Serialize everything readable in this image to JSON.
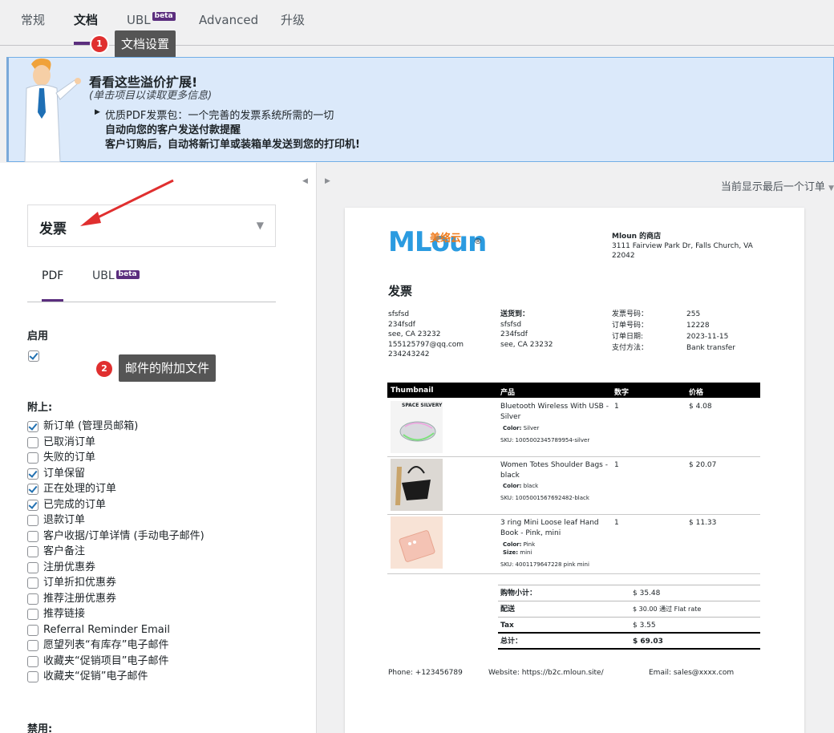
{
  "tabs": {
    "items": [
      {
        "label": "常规"
      },
      {
        "label": "文档"
      },
      {
        "label": "UBL",
        "badge": "beta"
      },
      {
        "label": "Advanced"
      },
      {
        "label": "升级"
      }
    ],
    "active": "文档"
  },
  "callouts": [
    {
      "num": "1",
      "label": "文档设置"
    },
    {
      "num": "2",
      "label": "邮件的附加文件"
    }
  ],
  "promo": {
    "title": "看看这些溢价扩展!",
    "subtitle": "(单击项目以读取更多信息)",
    "item1": "优质PDF发票包：一个完善的发票系统所需的一切",
    "item2": "自动向您的客户发送付款提醒",
    "item3": "客户订购后，自动将新订单或装箱单发送到您的打印机!"
  },
  "left": {
    "document_select": "发票",
    "subtabs": [
      {
        "label": "PDF"
      },
      {
        "label": "UBL",
        "badge": "beta"
      }
    ],
    "enable_label": "启用",
    "enable_checked": true,
    "attach_label": "附上:",
    "attach_items": [
      {
        "label": "新订单 (管理员邮箱)",
        "checked": true
      },
      {
        "label": "已取消订单",
        "checked": false
      },
      {
        "label": "失败的订单",
        "checked": false
      },
      {
        "label": "订单保留",
        "checked": true
      },
      {
        "label": "正在处理的订单",
        "checked": true
      },
      {
        "label": "已完成的订单",
        "checked": true
      },
      {
        "label": "退款订单",
        "checked": false
      },
      {
        "label": "客户收据/订单详情 (手动电子邮件)",
        "checked": false
      },
      {
        "label": "客户备注",
        "checked": false
      },
      {
        "label": "注册优惠券",
        "checked": false
      },
      {
        "label": "订单折扣优惠券",
        "checked": false
      },
      {
        "label": "推荐注册优惠券",
        "checked": false
      },
      {
        "label": "推荐链接",
        "checked": false
      },
      {
        "label": "Referral Reminder Email",
        "checked": false
      },
      {
        "label": "愿望列表“有库存”电子邮件",
        "checked": false
      },
      {
        "label": "收藏夹“促销项目”电子邮件",
        "checked": false
      },
      {
        "label": "收藏夹“促销”电子邮件",
        "checked": false
      }
    ],
    "disable_label": "禁用:"
  },
  "right": {
    "preview_select": "当前显示最后一个订单"
  },
  "invoice": {
    "logo_text": "MLoun",
    "logo_cn": "美络云",
    "shop_name": "Mloun 的商店",
    "shop_addr1": "3111 Fairview Park Dr, Falls Church, VA",
    "shop_addr2": "22042",
    "title": "发票",
    "billing": [
      "sfsfsd",
      "234fsdf",
      "see, CA 23232",
      "155125797@qq.com",
      "234243242"
    ],
    "ship_label": "送货到：",
    "shipping": [
      "sfsfsd",
      "234fsdf",
      "see, CA 23232"
    ],
    "meta": [
      {
        "k": "发票号码：",
        "v": "255"
      },
      {
        "k": "订单号码：",
        "v": "12228"
      },
      {
        "k": "订单日期:",
        "v": "2023-11-15"
      },
      {
        "k": "支付方法：",
        "v": "Bank transfer"
      }
    ],
    "columns": [
      "Thumbnail",
      "产品",
      "数字",
      "价格"
    ],
    "rows": [
      {
        "name1": "Bluetooth Wireless With USB -",
        "name2": "Silver",
        "color_label": "Color:",
        "color": "Silver",
        "size_label": "",
        "size": "",
        "sku": "SKU: 1005002345789954-silver",
        "qty": "1",
        "price": "$ 4.08",
        "thumb_text": "SPACE SILVERY"
      },
      {
        "name1": "Women Totes Shoulder Bags -",
        "name2": "black",
        "color_label": "Color:",
        "color": "black",
        "size_label": "",
        "size": "",
        "sku": "SKU: 1005001567692482-black",
        "qty": "1",
        "price": "$ 20.07",
        "thumb_text": ""
      },
      {
        "name1": "3 ring Mini Loose leaf Hand",
        "name2": "Book - Pink, mini",
        "color_label": "Color:",
        "color": "Pink",
        "size_label": "Size:",
        "size": "mini",
        "sku": "SKU: 4001179647228 pink mini",
        "qty": "1",
        "price": "$ 11.33",
        "thumb_text": ""
      }
    ],
    "totals": [
      {
        "k": "购物小计：",
        "v": "$ 35.48"
      },
      {
        "k": "配送",
        "v": "$ 30.00 通过 Flat rate"
      },
      {
        "k": "Tax",
        "v": "$ 3.55"
      },
      {
        "k": "总计：",
        "v": "$ 69.03"
      }
    ],
    "footer": {
      "phone": "Phone: +123456789",
      "website": "Website: https://b2c.mloun.site/",
      "email": "Email: sales@xxxx.com"
    }
  },
  "colors": {
    "accent": "#5b2e7e",
    "callout": "#e02f2f",
    "logo_blue": "#2b9be0",
    "logo_orange": "#ef7a1a",
    "checkbox": "#2271b1"
  }
}
